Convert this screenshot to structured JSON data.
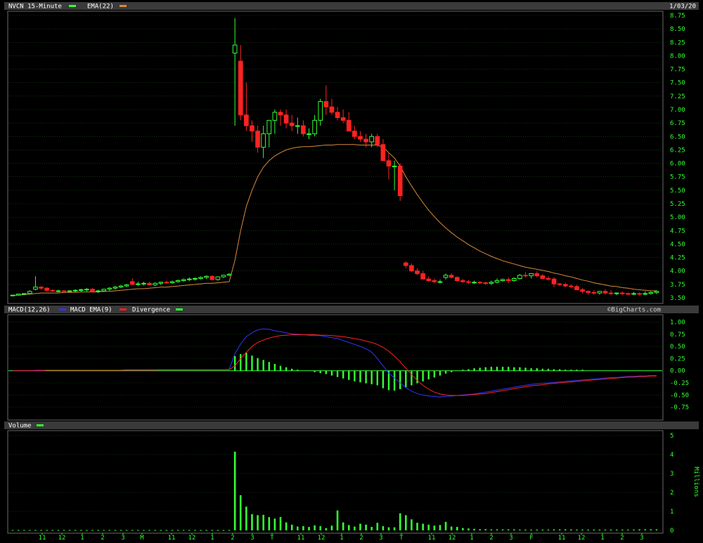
{
  "header": {
    "symbol_label": "NVCN 15-Minute",
    "ema_label": "EMA(22)",
    "date": "1/03/20"
  },
  "macd_header": {
    "macd_label": "MACD(12,26)",
    "ema_label": "MACD EMA(9)",
    "div_label": "Divergence",
    "watermark": "©BigCharts.com"
  },
  "volume_header": {
    "label": "Volume",
    "units": "Millions"
  },
  "colors": {
    "up": "#33ff33",
    "down": "#ff2222",
    "ema": "#d98a3a",
    "macd": "#3333ff",
    "signal": "#ff2222",
    "hist": "#33ff33",
    "grid": "#1f4d1f",
    "panel_border": "#6a6a6a",
    "tick_text": "#33ff33",
    "header_text": "#ffffff"
  },
  "chart_data": [
    {
      "type": "candlestick",
      "title": "NVCN 15-Minute",
      "legend": [
        "NVCN 15-Minute",
        "EMA(22)"
      ],
      "ylim": [
        3.5,
        8.75
      ],
      "y_ticks": [
        "8.75",
        "8.50",
        "8.25",
        "8.00",
        "7.75",
        "7.50",
        "7.25",
        "7.00",
        "6.75",
        "6.50",
        "6.25",
        "6.00",
        "5.75",
        "5.50",
        "5.25",
        "5.00",
        "4.75",
        "4.50",
        "4.25",
        "4.00",
        "3.75",
        "3.50"
      ],
      "x_ticks": [
        "11",
        "12",
        "1",
        "2",
        "3",
        "M",
        "11",
        "12",
        "1",
        "2",
        "3",
        "T",
        "11",
        "12",
        "1",
        "2",
        "3",
        "T",
        "11",
        "12",
        "1",
        "2",
        "3",
        "F",
        "11",
        "12",
        "1",
        "2",
        "3"
      ],
      "grid": true,
      "prices": {
        "open": [
          3.54,
          3.55,
          3.57,
          3.58,
          3.66,
          3.7,
          3.68,
          3.64,
          3.63,
          3.63,
          3.62,
          3.63,
          3.64,
          3.65,
          3.66,
          3.62,
          3.63,
          3.66,
          3.68,
          3.7,
          3.72,
          3.8,
          3.75,
          3.76,
          3.77,
          3.74,
          3.77,
          3.79,
          3.78,
          3.8,
          3.82,
          3.84,
          3.85,
          3.86,
          3.88,
          3.9,
          3.84,
          3.89,
          3.92,
          8.05,
          7.9,
          6.9,
          6.7,
          6.6,
          6.3,
          6.55,
          6.8,
          6.95,
          6.9,
          6.75,
          6.7,
          6.7,
          6.55,
          6.55,
          6.8,
          7.15,
          7.05,
          6.95,
          6.85,
          6.8,
          6.6,
          6.5,
          6.45,
          6.4,
          6.5,
          6.35,
          6.05,
          5.95,
          5.95,
          4.15,
          4.1,
          4.0,
          3.95,
          3.85,
          3.82,
          3.8,
          3.88,
          3.92,
          3.88,
          3.82,
          3.8,
          3.79,
          3.79,
          3.78,
          3.77,
          3.79,
          3.82,
          3.84,
          3.82,
          3.86,
          3.92,
          3.91,
          3.95,
          3.91,
          3.86,
          3.85,
          3.76,
          3.75,
          3.72,
          3.71,
          3.65,
          3.62,
          3.6,
          3.59,
          3.62,
          3.59,
          3.58,
          3.59,
          3.58,
          3.57,
          3.58,
          3.57,
          3.58,
          3.6
        ],
        "high": [
          3.55,
          3.57,
          3.58,
          3.64,
          3.9,
          3.72,
          3.7,
          3.66,
          3.65,
          3.64,
          3.64,
          3.66,
          3.67,
          3.68,
          3.68,
          3.65,
          3.67,
          3.7,
          3.72,
          3.74,
          3.76,
          3.86,
          3.8,
          3.8,
          3.8,
          3.79,
          3.8,
          3.82,
          3.82,
          3.84,
          3.86,
          3.88,
          3.88,
          3.9,
          3.92,
          3.92,
          3.9,
          3.93,
          3.96,
          8.7,
          8.2,
          7.5,
          6.8,
          6.7,
          6.7,
          6.7,
          7.0,
          7.0,
          7.0,
          6.9,
          6.85,
          6.8,
          6.65,
          6.9,
          7.2,
          7.45,
          7.2,
          7.05,
          7.0,
          6.95,
          6.7,
          6.6,
          6.55,
          6.55,
          6.55,
          6.45,
          6.2,
          6.05,
          6.0,
          4.18,
          4.14,
          4.05,
          4.0,
          3.9,
          3.86,
          3.84,
          3.95,
          3.96,
          3.9,
          3.85,
          3.83,
          3.82,
          3.81,
          3.8,
          3.82,
          3.86,
          3.86,
          3.88,
          3.88,
          3.94,
          3.98,
          3.96,
          3.99,
          3.94,
          3.9,
          3.88,
          3.78,
          3.78,
          3.75,
          3.74,
          3.68,
          3.64,
          3.64,
          3.63,
          3.66,
          3.64,
          3.6,
          3.62,
          3.6,
          3.61,
          3.6,
          3.62,
          3.62,
          3.64
        ],
        "low": [
          3.53,
          3.54,
          3.55,
          3.56,
          3.64,
          3.65,
          3.62,
          3.61,
          3.6,
          3.6,
          3.6,
          3.6,
          3.61,
          3.62,
          3.6,
          3.59,
          3.61,
          3.63,
          3.65,
          3.68,
          3.7,
          3.74,
          3.72,
          3.73,
          3.74,
          3.72,
          3.74,
          3.76,
          3.76,
          3.78,
          3.8,
          3.81,
          3.82,
          3.84,
          3.85,
          3.82,
          3.82,
          3.87,
          3.9,
          6.7,
          6.8,
          6.6,
          6.4,
          6.2,
          6.1,
          6.3,
          6.55,
          6.7,
          6.65,
          6.6,
          6.55,
          6.5,
          6.45,
          6.5,
          6.7,
          6.9,
          6.9,
          6.8,
          6.75,
          6.7,
          6.45,
          6.4,
          6.3,
          6.3,
          6.3,
          6.05,
          5.7,
          5.5,
          5.3,
          4.05,
          3.98,
          3.92,
          3.84,
          3.8,
          3.77,
          3.77,
          3.84,
          3.86,
          3.8,
          3.78,
          3.76,
          3.76,
          3.76,
          3.74,
          3.74,
          3.77,
          3.8,
          3.78,
          3.8,
          3.84,
          3.88,
          3.86,
          3.88,
          3.85,
          3.82,
          3.7,
          3.72,
          3.7,
          3.68,
          3.64,
          3.58,
          3.56,
          3.56,
          3.56,
          3.56,
          3.55,
          3.55,
          3.55,
          3.55,
          3.55,
          3.54,
          3.55,
          3.56,
          3.57
        ],
        "close": [
          3.55,
          3.57,
          3.58,
          3.62,
          3.7,
          3.68,
          3.64,
          3.63,
          3.63,
          3.62,
          3.63,
          3.64,
          3.65,
          3.66,
          3.62,
          3.63,
          3.66,
          3.68,
          3.7,
          3.72,
          3.74,
          3.75,
          3.76,
          3.77,
          3.74,
          3.77,
          3.79,
          3.78,
          3.8,
          3.82,
          3.84,
          3.85,
          3.86,
          3.88,
          3.9,
          3.84,
          3.89,
          3.92,
          3.94,
          8.2,
          6.9,
          6.7,
          6.6,
          6.3,
          6.55,
          6.8,
          6.95,
          6.9,
          6.75,
          6.7,
          6.7,
          6.55,
          6.55,
          6.8,
          7.15,
          7.05,
          6.95,
          6.85,
          6.8,
          6.6,
          6.5,
          6.45,
          6.4,
          6.5,
          6.35,
          6.05,
          5.95,
          5.95,
          5.4,
          4.1,
          4.0,
          3.95,
          3.85,
          3.82,
          3.8,
          3.8,
          3.92,
          3.88,
          3.82,
          3.8,
          3.79,
          3.79,
          3.78,
          3.77,
          3.79,
          3.82,
          3.84,
          3.82,
          3.86,
          3.92,
          3.91,
          3.95,
          3.91,
          3.86,
          3.85,
          3.76,
          3.75,
          3.72,
          3.71,
          3.65,
          3.62,
          3.6,
          3.59,
          3.62,
          3.59,
          3.58,
          3.59,
          3.58,
          3.57,
          3.58,
          3.57,
          3.58,
          3.6,
          3.62
        ]
      },
      "ema": [
        3.55,
        3.55,
        3.56,
        3.57,
        3.58,
        3.59,
        3.59,
        3.59,
        3.59,
        3.6,
        3.6,
        3.6,
        3.61,
        3.61,
        3.61,
        3.61,
        3.62,
        3.62,
        3.63,
        3.64,
        3.65,
        3.66,
        3.67,
        3.67,
        3.68,
        3.69,
        3.7,
        3.7,
        3.71,
        3.72,
        3.73,
        3.74,
        3.75,
        3.76,
        3.77,
        3.77,
        3.78,
        3.79,
        3.8,
        4.2,
        4.75,
        5.2,
        5.5,
        5.75,
        5.93,
        6.05,
        6.14,
        6.2,
        6.25,
        6.28,
        6.3,
        6.31,
        6.31,
        6.32,
        6.33,
        6.34,
        6.34,
        6.35,
        6.35,
        6.35,
        6.35,
        6.34,
        6.34,
        6.34,
        6.34,
        6.3,
        6.2,
        6.1,
        5.95,
        5.75,
        5.58,
        5.42,
        5.27,
        5.13,
        5.01,
        4.9,
        4.8,
        4.71,
        4.63,
        4.56,
        4.49,
        4.43,
        4.37,
        4.32,
        4.27,
        4.23,
        4.19,
        4.16,
        4.13,
        4.1,
        4.07,
        4.05,
        4.03,
        4.01,
        3.99,
        3.96,
        3.94,
        3.91,
        3.89,
        3.86,
        3.83,
        3.81,
        3.78,
        3.76,
        3.74,
        3.72,
        3.71,
        3.69,
        3.68,
        3.66,
        3.65,
        3.64,
        3.63,
        3.63
      ],
      "macd": {
        "ylim": [
          -0.9,
          1.05
        ],
        "y_ticks": [
          "1.00",
          "0.75",
          "0.50",
          "0.25",
          "0.00",
          "-0.25",
          "-0.50",
          "-0.75"
        ],
        "legend": [
          "MACD(12,26)",
          "MACD EMA(9)",
          "Divergence"
        ],
        "macd_line": [
          0.0,
          0.0,
          0.0,
          0.0,
          0.01,
          0.01,
          0.01,
          0.01,
          0.01,
          0.01,
          0.01,
          0.01,
          0.01,
          0.01,
          0.01,
          0.01,
          0.01,
          0.01,
          0.01,
          0.01,
          0.02,
          0.02,
          0.02,
          0.02,
          0.02,
          0.02,
          0.02,
          0.02,
          0.02,
          0.02,
          0.02,
          0.02,
          0.02,
          0.02,
          0.02,
          0.02,
          0.02,
          0.02,
          0.03,
          0.35,
          0.55,
          0.7,
          0.78,
          0.84,
          0.86,
          0.85,
          0.82,
          0.8,
          0.78,
          0.76,
          0.75,
          0.74,
          0.73,
          0.72,
          0.72,
          0.7,
          0.68,
          0.66,
          0.62,
          0.58,
          0.54,
          0.5,
          0.45,
          0.38,
          0.25,
          0.1,
          -0.05,
          -0.15,
          -0.25,
          -0.35,
          -0.42,
          -0.47,
          -0.5,
          -0.52,
          -0.53,
          -0.54,
          -0.53,
          -0.52,
          -0.51,
          -0.5,
          -0.49,
          -0.48,
          -0.46,
          -0.44,
          -0.42,
          -0.4,
          -0.38,
          -0.36,
          -0.34,
          -0.32,
          -0.3,
          -0.28,
          -0.27,
          -0.26,
          -0.25,
          -0.24,
          -0.23,
          -0.22,
          -0.21,
          -0.2,
          -0.19,
          -0.18,
          -0.17,
          -0.16,
          -0.15,
          -0.14,
          -0.14,
          -0.13,
          -0.12,
          -0.12,
          -0.11,
          -0.11,
          -0.1,
          -0.1
        ],
        "signal_line": [
          0.0,
          0.0,
          0.0,
          0.0,
          0.0,
          0.0,
          0.01,
          0.01,
          0.01,
          0.01,
          0.01,
          0.01,
          0.01,
          0.01,
          0.01,
          0.01,
          0.01,
          0.01,
          0.01,
          0.01,
          0.01,
          0.01,
          0.01,
          0.01,
          0.01,
          0.01,
          0.02,
          0.02,
          0.02,
          0.02,
          0.02,
          0.02,
          0.02,
          0.02,
          0.02,
          0.02,
          0.02,
          0.02,
          0.02,
          0.1,
          0.25,
          0.38,
          0.5,
          0.58,
          0.63,
          0.67,
          0.7,
          0.72,
          0.73,
          0.74,
          0.74,
          0.74,
          0.74,
          0.74,
          0.73,
          0.73,
          0.72,
          0.71,
          0.7,
          0.68,
          0.66,
          0.64,
          0.61,
          0.58,
          0.54,
          0.48,
          0.4,
          0.3,
          0.18,
          0.05,
          -0.08,
          -0.2,
          -0.3,
          -0.38,
          -0.44,
          -0.48,
          -0.5,
          -0.51,
          -0.51,
          -0.51,
          -0.5,
          -0.49,
          -0.48,
          -0.47,
          -0.45,
          -0.43,
          -0.41,
          -0.39,
          -0.37,
          -0.35,
          -0.33,
          -0.31,
          -0.3,
          -0.29,
          -0.27,
          -0.26,
          -0.25,
          -0.24,
          -0.23,
          -0.22,
          -0.21,
          -0.2,
          -0.19,
          -0.18,
          -0.17,
          -0.16,
          -0.15,
          -0.14,
          -0.13,
          -0.13,
          -0.12,
          -0.12,
          -0.11,
          -0.11
        ],
        "divergence": [
          0.0,
          0.0,
          0.0,
          0.0,
          0.0,
          0.0,
          0.0,
          0.0,
          0.0,
          0.0,
          0.0,
          0.0,
          0.0,
          0.0,
          0.0,
          0.0,
          0.0,
          0.0,
          0.0,
          0.0,
          0.0,
          0.0,
          0.0,
          0.0,
          0.0,
          0.0,
          0.0,
          0.0,
          0.0,
          0.0,
          0.0,
          0.0,
          0.0,
          0.0,
          0.0,
          0.0,
          0.0,
          0.0,
          0.0,
          0.3,
          0.34,
          0.37,
          0.31,
          0.26,
          0.22,
          0.18,
          0.14,
          0.1,
          0.07,
          0.04,
          0.02,
          0.0,
          -0.01,
          -0.03,
          -0.05,
          -0.07,
          -0.1,
          -0.13,
          -0.16,
          -0.19,
          -0.22,
          -0.24,
          -0.26,
          -0.28,
          -0.3,
          -0.36,
          -0.4,
          -0.41,
          -0.38,
          -0.34,
          -0.3,
          -0.26,
          -0.22,
          -0.18,
          -0.14,
          -0.1,
          -0.06,
          -0.03,
          0.0,
          0.02,
          0.03,
          0.05,
          0.06,
          0.07,
          0.08,
          0.08,
          0.08,
          0.08,
          0.07,
          0.07,
          0.06,
          0.05,
          0.05,
          0.04,
          0.04,
          0.03,
          0.03,
          0.02,
          0.02,
          0.02,
          0.02,
          0.01,
          0.01,
          0.01,
          0.01,
          0.01,
          0.01,
          0.01,
          0.01,
          0.01,
          0.01,
          0.01,
          0.01,
          0.01
        ]
      },
      "volume": {
        "ylim": [
          0,
          5
        ],
        "y_ticks": [
          "5",
          "4",
          "3",
          "2",
          "1",
          "0"
        ],
        "units": "Millions",
        "values": [
          0.02,
          0.02,
          0.02,
          0.02,
          0.02,
          0.02,
          0.02,
          0.02,
          0.02,
          0.02,
          0.02,
          0.02,
          0.02,
          0.02,
          0.02,
          0.02,
          0.02,
          0.02,
          0.02,
          0.02,
          0.02,
          0.02,
          0.02,
          0.02,
          0.02,
          0.02,
          0.02,
          0.02,
          0.02,
          0.02,
          0.02,
          0.02,
          0.02,
          0.02,
          0.02,
          0.02,
          0.02,
          0.02,
          0.02,
          4.15,
          1.85,
          1.25,
          0.85,
          0.8,
          0.82,
          0.7,
          0.62,
          0.7,
          0.42,
          0.3,
          0.2,
          0.22,
          0.18,
          0.26,
          0.22,
          0.12,
          0.25,
          1.05,
          0.42,
          0.28,
          0.2,
          0.35,
          0.3,
          0.18,
          0.4,
          0.22,
          0.16,
          0.16,
          0.9,
          0.8,
          0.58,
          0.4,
          0.35,
          0.3,
          0.25,
          0.28,
          0.45,
          0.2,
          0.18,
          0.12,
          0.1,
          0.08,
          0.06,
          0.06,
          0.05,
          0.05,
          0.05,
          0.05,
          0.05,
          0.04,
          0.04,
          0.04,
          0.04,
          0.04,
          0.04,
          0.05,
          0.05,
          0.05,
          0.05,
          0.04,
          0.04,
          0.04,
          0.04,
          0.04,
          0.04,
          0.04,
          0.04,
          0.04,
          0.04,
          0.04,
          0.05,
          0.05,
          0.05,
          0.05
        ]
      }
    }
  ]
}
